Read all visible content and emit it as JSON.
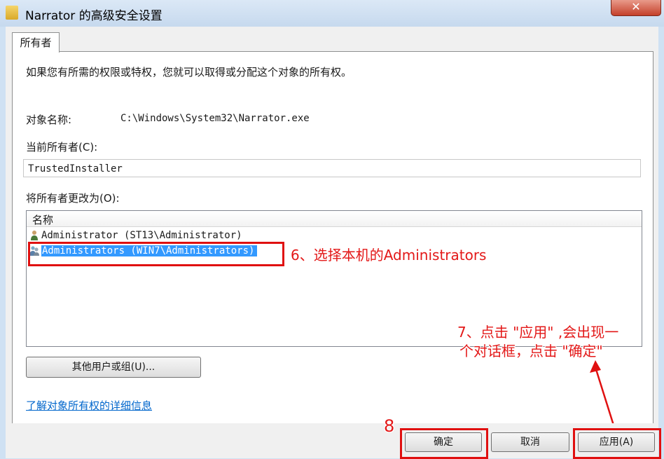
{
  "window": {
    "title": "Narrator 的高级安全设置",
    "close_symbol": "✕"
  },
  "tab": {
    "label": "所有者"
  },
  "description": "如果您有所需的权限或特权，您就可以取得或分配这个对象的所有权。",
  "object_name": {
    "label": "对象名称:",
    "value": "C:\\Windows\\System32\\Narrator.exe"
  },
  "current_owner": {
    "label": "当前所有者(C):",
    "value": "TrustedInstaller"
  },
  "change_owner": {
    "label": "将所有者更改为(O):",
    "column_header": "名称",
    "items": [
      {
        "label": "Administrator (ST13\\Administrator)",
        "icon": "user-icon",
        "selected": false
      },
      {
        "label": "Administrators (WIN7\\Administrators)",
        "icon": "users-group-icon",
        "selected": true
      }
    ]
  },
  "other_users_button": "其他用户或组(U)...",
  "learn_more_link": "了解对象所有权的详细信息",
  "buttons": {
    "ok": "确定",
    "cancel": "取消",
    "apply": "应用(A)"
  },
  "annotations": {
    "step6": "6、选择本机的Administrators",
    "step7_line1": "7、点击 \"应用\" ,会出现一",
    "step7_line2": "个对话框，点击 \"确定\"",
    "step8": "8"
  },
  "colors": {
    "annotation_red": "#e01010",
    "selection_blue": "#3399ff",
    "link_blue": "#0066cc"
  }
}
